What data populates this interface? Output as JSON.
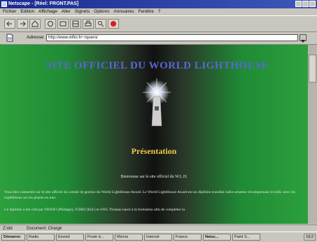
{
  "window": {
    "title": "Netscape - [Réel: FRONT.PAS]"
  },
  "menu": [
    "Fichier",
    "Edition",
    "Affichage",
    "Aller",
    "Signets",
    "Options",
    "Annuaires",
    "Fenêtre",
    "?"
  ],
  "address": {
    "label": "Adresse:",
    "value": "http://www.infini.fr/~tquero/"
  },
  "page": {
    "title": "SITE OFFICIEL DU WORLD LIGHTHOUSE",
    "section": "Présentation",
    "welcome": "Bienvenue sur le site officiel du W.L.H.",
    "para1": "Vous êtes connectés sur le site officiel du comité de gestion du World LightHouse Award. Le World LightHouse Award est un diplôme mondial radio-amateur récompensant le trafic avec les expéditions sur les phares en mer.",
    "para2": "Ce diplôme a été créé par F6OOO (Philippe), F5HEI (Eric) et SWL Thomas lancé à la formation afin de compléter la"
  },
  "status": {
    "left": "Z:\\dd",
    "text": "Document: Chargé"
  },
  "taskbar": {
    "start": "Démarrer",
    "items": [
      "Radio",
      "Exvoid",
      "Poste d...",
      "Micros",
      "Internet",
      "France",
      "Netsc...",
      "Paint S..."
    ],
    "clock": "16:2"
  },
  "colors": {
    "accent_title": "#5a66d6",
    "section": "#f2c84a",
    "bg_green": "#2ca03c"
  }
}
